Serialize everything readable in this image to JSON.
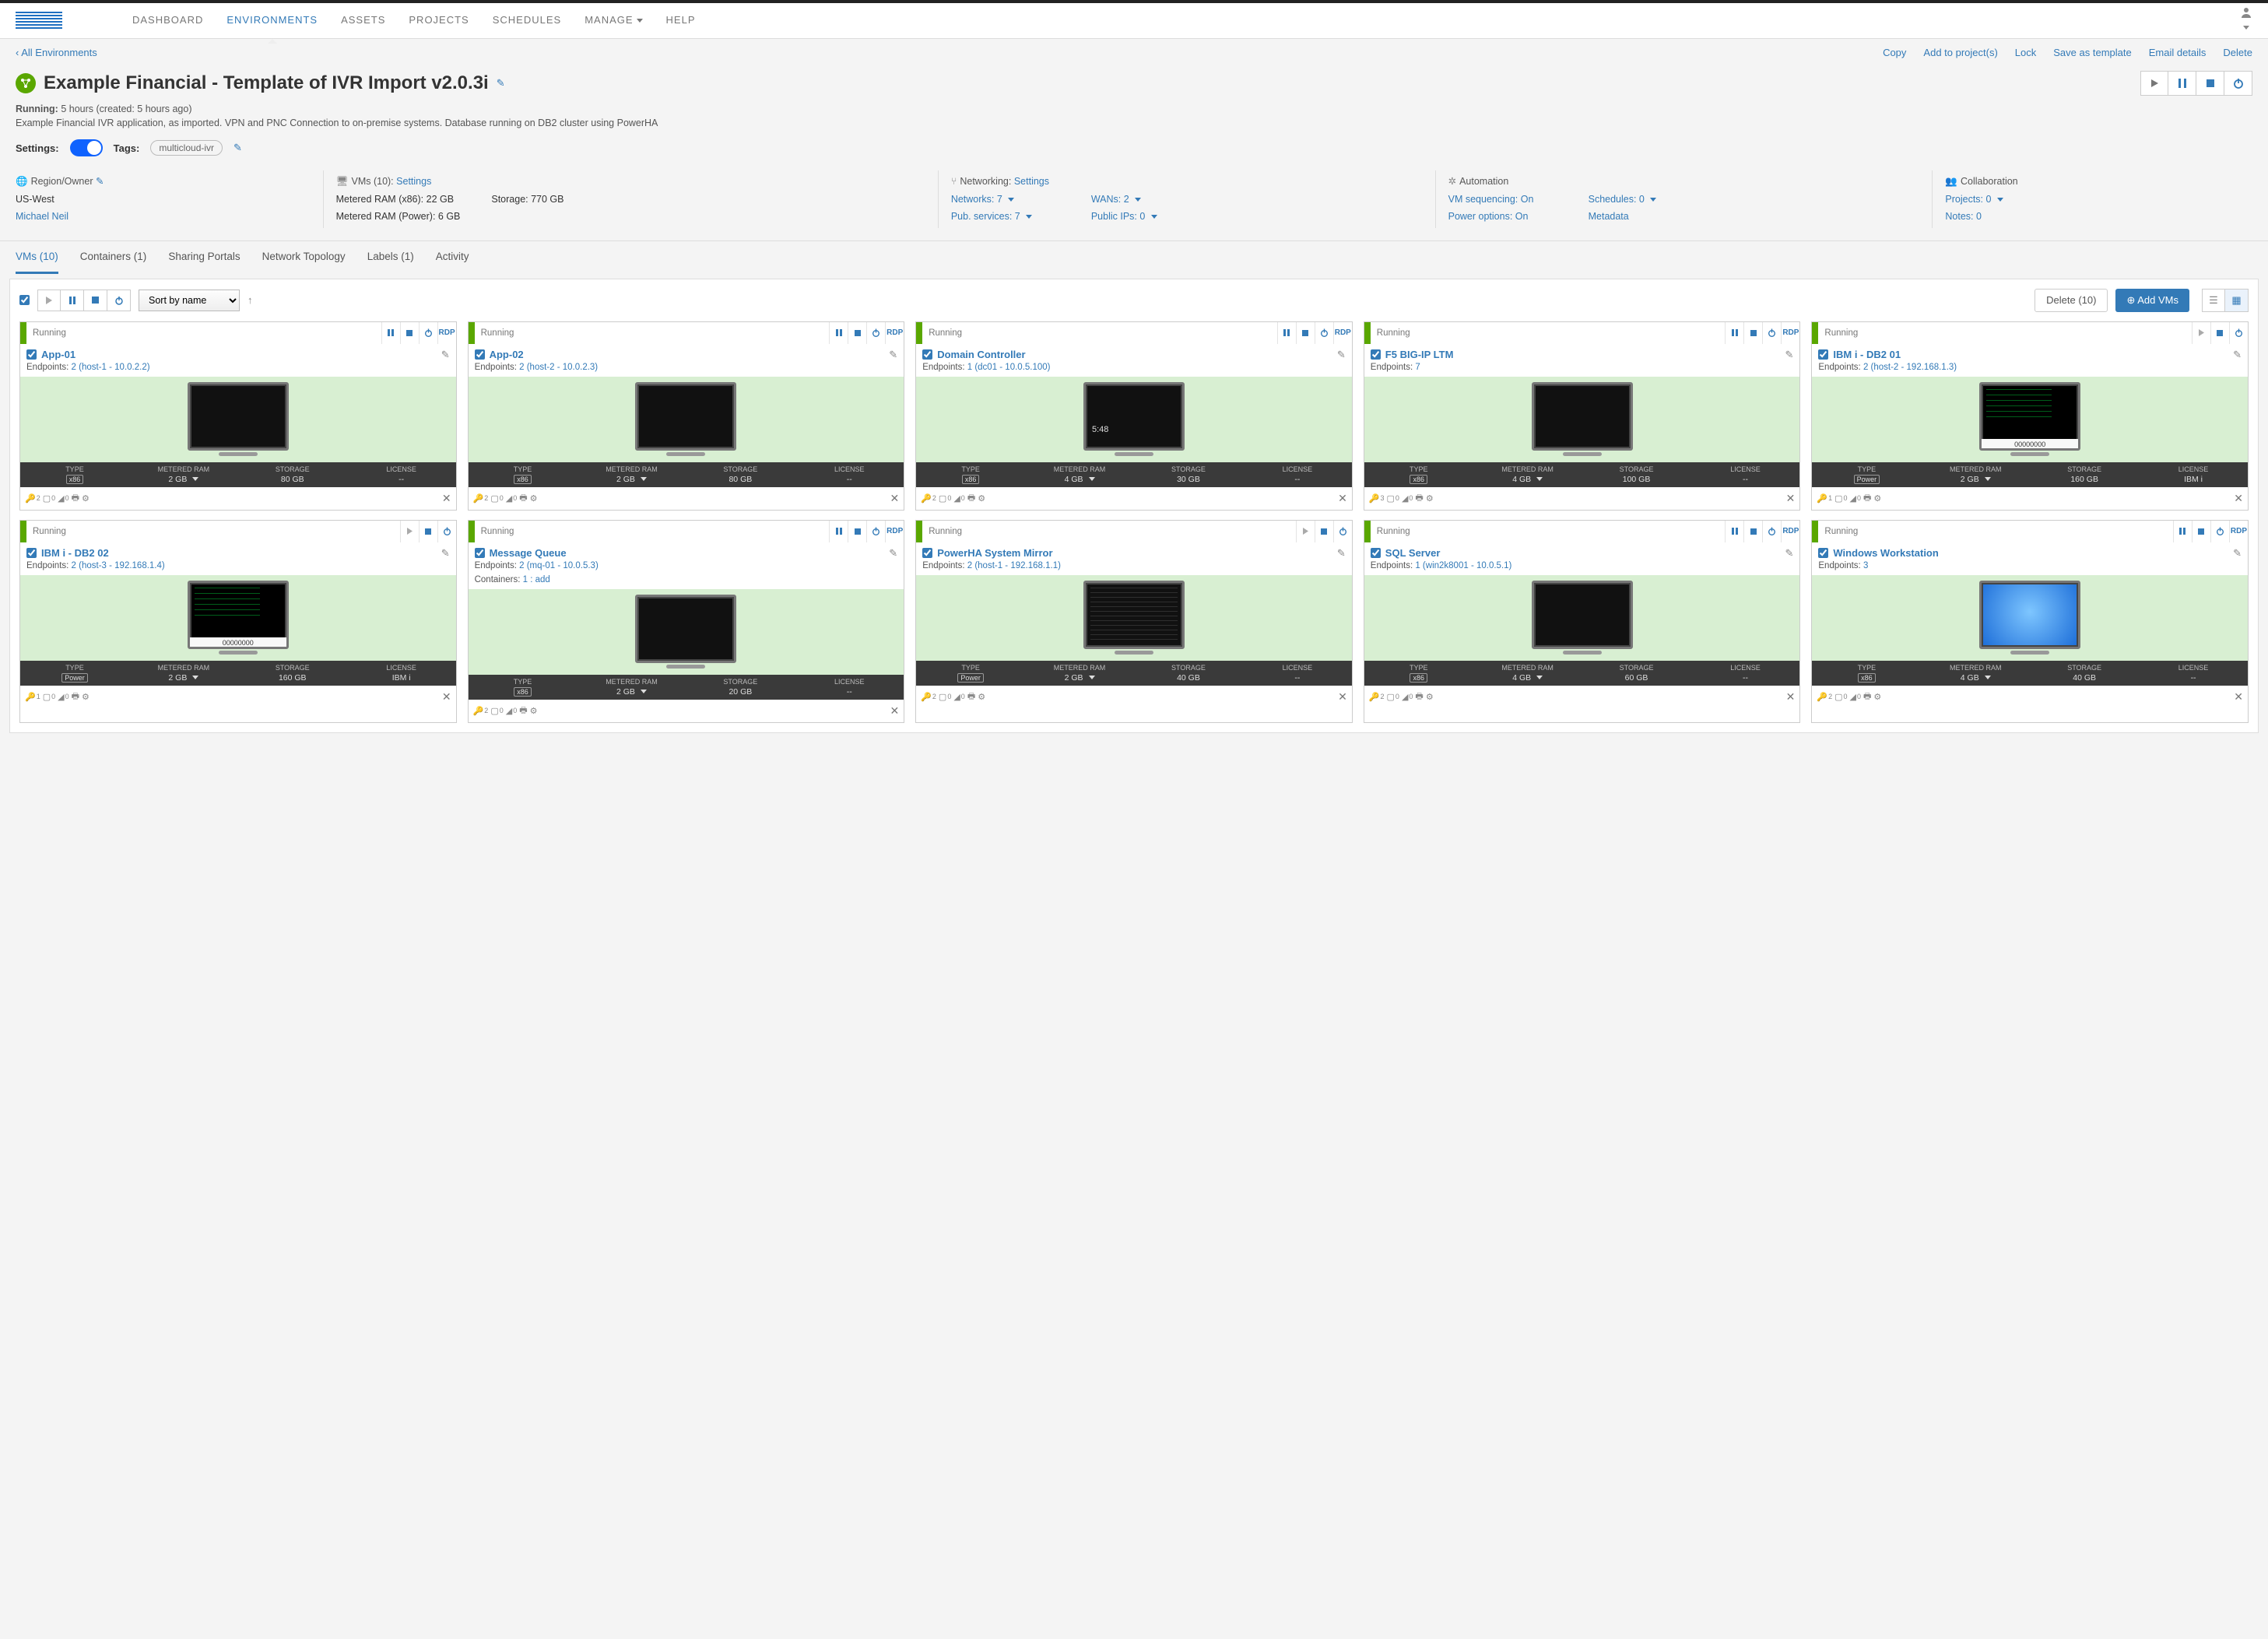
{
  "nav": {
    "items": [
      "DASHBOARD",
      "ENVIRONMENTS",
      "ASSETS",
      "PROJECTS",
      "SCHEDULES",
      "MANAGE",
      "HELP"
    ],
    "active": 1
  },
  "breadcrumb": "All Environments",
  "header_actions": [
    "Copy",
    "Add to project(s)",
    "Lock",
    "Save as template",
    "Email details",
    "Delete"
  ],
  "env": {
    "title": "Example Financial - Template of IVR Import v2.0.3i",
    "running_label": "Running:",
    "running_value": "5 hours (created: 5 hours ago)",
    "description": "Example Financial IVR application, as imported. VPN and PNC Connection to on-premise systems. Database running on DB2 cluster using PowerHA",
    "settings_label": "Settings:",
    "tags_label": "Tags:",
    "tag": "multicloud-ivr"
  },
  "info": {
    "region": {
      "heading": "Region/Owner",
      "region": "US-West",
      "owner": "Michael Neil"
    },
    "vms": {
      "heading": "VMs (10):",
      "settings": "Settings",
      "ram_x86": "Metered RAM (x86): 22 GB",
      "ram_power": "Metered RAM (Power): 6 GB",
      "storage": "Storage: 770 GB"
    },
    "net": {
      "heading": "Networking:",
      "settings": "Settings",
      "networks": "Networks: 7",
      "pub": "Pub. services: 7",
      "wans": "WANs: 2",
      "ips": "Public IPs: 0"
    },
    "auto": {
      "heading": "Automation",
      "seq": "VM sequencing: On",
      "power": "Power options: On",
      "sched": "Schedules: 0",
      "meta": "Metadata"
    },
    "collab": {
      "heading": "Collaboration",
      "projects": "Projects: 0",
      "notes": "Notes: 0"
    }
  },
  "tabs": [
    "VMs (10)",
    "Containers (1)",
    "Sharing Portals",
    "Network Topology",
    "Labels (1)",
    "Activity"
  ],
  "toolbar": {
    "sort": "Sort by name",
    "delete": "Delete (10)",
    "add": "⊕ Add VMs"
  },
  "vms": [
    {
      "name": "App-01",
      "status": "Running",
      "endpoints": "2 (host-1 - 10.0.2.2)",
      "type": "x86",
      "ram": "2 GB",
      "storage": "80 GB",
      "license": "--",
      "rdp": true,
      "controls": "pause-stop-power",
      "screen": "black",
      "keys": 2,
      "containers": 0,
      "disks": 0
    },
    {
      "name": "App-02",
      "status": "Running",
      "endpoints": "2 (host-2 - 10.0.2.3)",
      "type": "x86",
      "ram": "2 GB",
      "storage": "80 GB",
      "license": "--",
      "rdp": true,
      "controls": "pause-stop-power",
      "screen": "black",
      "keys": 2,
      "containers": 0,
      "disks": 0
    },
    {
      "name": "Domain Controller",
      "status": "Running",
      "endpoints": "1 (dc01 - 10.0.5.100)",
      "type": "x86",
      "ram": "4 GB",
      "storage": "30 GB",
      "license": "--",
      "rdp": true,
      "controls": "pause-stop-power",
      "screen": "clock",
      "keys": 2,
      "containers": 0,
      "disks": 0
    },
    {
      "name": "F5 BIG-IP LTM",
      "status": "Running",
      "endpoints": "7",
      "type": "x86",
      "ram": "4 GB",
      "storage": "100 GB",
      "license": "--",
      "rdp": true,
      "controls": "pause-stop-power",
      "screen": "black",
      "keys": 3,
      "containers": 0,
      "disks": 0
    },
    {
      "name": "IBM i - DB2 01",
      "status": "Running",
      "endpoints": "2 (host-2 - 192.168.1.3)",
      "type": "Power",
      "ram": "2 GB",
      "storage": "160 GB",
      "license": "IBM i",
      "rdp": false,
      "controls": "play-stop-power",
      "screen": "term",
      "label": "00000000",
      "keys": 1,
      "containers": 0,
      "disks": 0
    },
    {
      "name": "IBM i - DB2 02",
      "status": "Running",
      "endpoints": "2 (host-3 - 192.168.1.4)",
      "type": "Power",
      "ram": "2 GB",
      "storage": "160 GB",
      "license": "IBM i",
      "rdp": false,
      "controls": "play-stop-power",
      "screen": "term",
      "label": "00000000",
      "keys": 1,
      "containers": 0,
      "disks": 0
    },
    {
      "name": "Message Queue",
      "status": "Running",
      "endpoints": "2 (mq-01 - 10.0.5.3)",
      "containers_line": "1 : add",
      "type": "x86",
      "ram": "2 GB",
      "storage": "20 GB",
      "license": "--",
      "rdp": true,
      "controls": "pause-stop-power",
      "screen": "black",
      "keys": 2,
      "containers": 0,
      "disks": 0
    },
    {
      "name": "PowerHA System Mirror",
      "status": "Running",
      "endpoints": "2 (host-1 - 192.168.1.1)",
      "type": "Power",
      "ram": "2 GB",
      "storage": "40 GB",
      "license": "--",
      "rdp": false,
      "controls": "play-stop-power",
      "screen": "txt",
      "keys": 2,
      "containers": 0,
      "disks": 0
    },
    {
      "name": "SQL Server",
      "status": "Running",
      "endpoints": "1 (win2k8001 - 10.0.5.1)",
      "type": "x86",
      "ram": "4 GB",
      "storage": "60 GB",
      "license": "--",
      "rdp": true,
      "controls": "pause-stop-power",
      "screen": "black",
      "keys": 2,
      "containers": 0,
      "disks": 0
    },
    {
      "name": "Windows Workstation",
      "status": "Running",
      "endpoints": "3",
      "type": "x86",
      "ram": "4 GB",
      "storage": "40 GB",
      "license": "--",
      "rdp": true,
      "controls": "pause-stop-power",
      "screen": "win",
      "keys": 2,
      "containers": 0,
      "disks": 0
    }
  ],
  "stat_headers": {
    "type": "TYPE",
    "ram": "METERED RAM",
    "storage": "STORAGE",
    "license": "LICENSE"
  },
  "endpoint_label": "Endpoints:",
  "containers_label": "Containers:"
}
